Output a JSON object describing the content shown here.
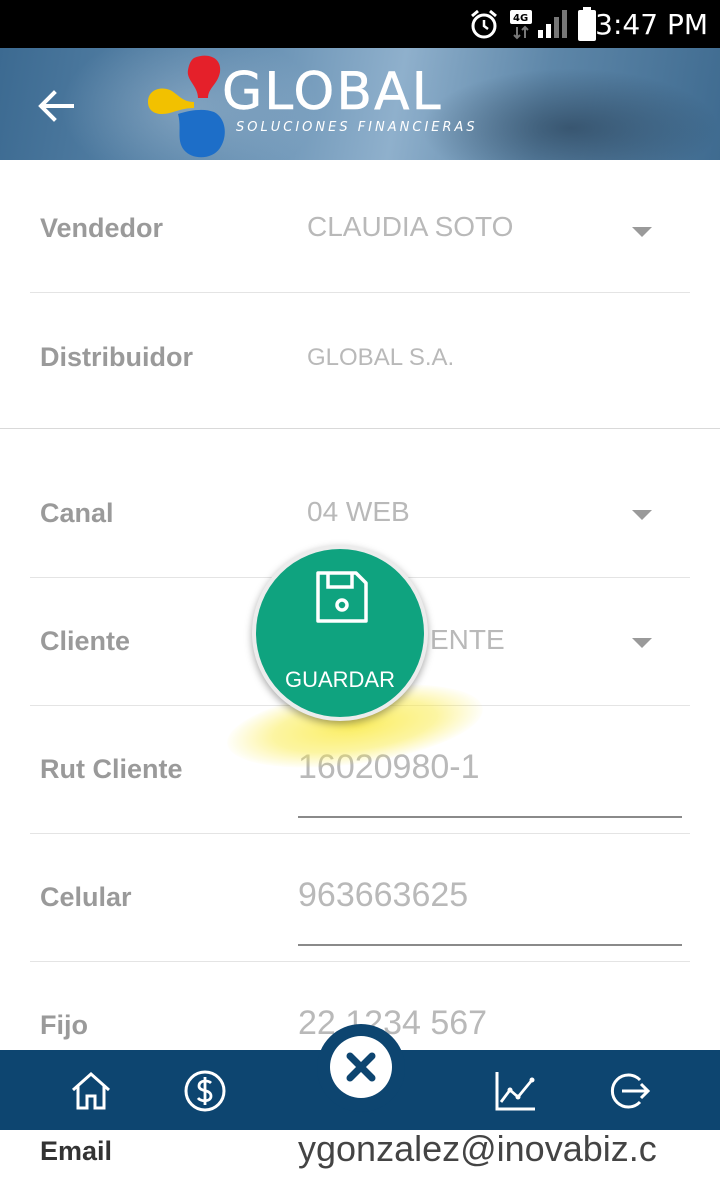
{
  "status_bar": {
    "time": "3:47 PM",
    "network": "4G"
  },
  "header": {
    "back_icon": "arrow-left-icon",
    "logo_title": "GLOBAL",
    "logo_subtitle": "SOLUCIONES FINANCIERAS"
  },
  "form": {
    "vendedor": {
      "label": "Vendedor",
      "value": "CLAUDIA SOTO"
    },
    "distribuidor": {
      "label": "Distribuidor",
      "value": "GLOBAL S.A."
    },
    "canal": {
      "label": "Canal",
      "value": "04 WEB"
    },
    "cliente": {
      "label": "Cliente",
      "value": "ENTE"
    },
    "rut_cliente": {
      "label": "Rut Cliente",
      "placeholder": "16020980-1"
    },
    "celular": {
      "label": "Celular",
      "placeholder": "963663625"
    },
    "fijo": {
      "label": "Fijo",
      "placeholder": "22 1234 567"
    },
    "email": {
      "label": "Email",
      "value": "ygonzalez@inovabiz.c"
    }
  },
  "fab": {
    "label": "GUARDAR",
    "icon": "floppy-disk-icon"
  },
  "bottom_nav": {
    "items": [
      {
        "icon": "home-icon"
      },
      {
        "icon": "dollar-circle-icon"
      },
      {
        "icon": "close-icon"
      },
      {
        "icon": "line-chart-icon"
      },
      {
        "icon": "logout-icon"
      }
    ]
  },
  "colors": {
    "accent_green": "#0fa37f",
    "nav_blue": "#0d4570",
    "highlight_yellow": "#f5e84a"
  }
}
